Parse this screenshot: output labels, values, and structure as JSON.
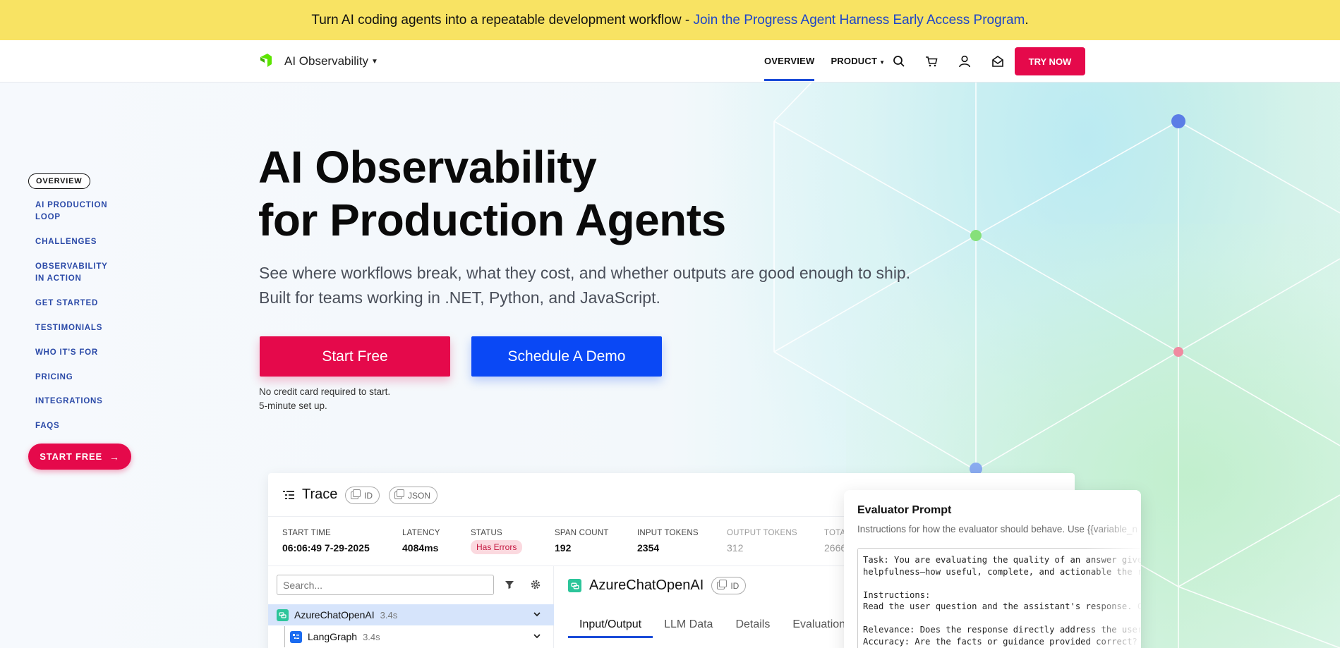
{
  "banner": {
    "text": "Turn AI coding agents into a repeatable development workflow - ",
    "link": "Join the Progress Agent Harness Early Access Program",
    "end": "."
  },
  "nav": {
    "product_name": "AI Observability",
    "overview": "OVERVIEW",
    "product": "PRODUCT",
    "try_now": "TRY NOW",
    "icons": [
      "search-icon",
      "cart-icon",
      "user-icon",
      "mail-icon"
    ]
  },
  "sidenav": {
    "active": "OVERVIEW",
    "items": [
      "AI PRODUCTION LOOP",
      "CHALLENGES",
      "OBSERVABILITY IN ACTION",
      "GET STARTED",
      "TESTIMONIALS",
      "WHO IT'S FOR",
      "PRICING",
      "INTEGRATIONS",
      "FAQS"
    ],
    "cta": "START FREE"
  },
  "hero": {
    "title_line1": "AI Observability",
    "title_line2": "for Production Agents",
    "subtitle_line1": "See where workflows break, what they cost, and whether outputs are good enough to ship.",
    "subtitle_line2": "Built for teams working in .NET, Python, and JavaScript.",
    "start_free": "Start Free",
    "schedule_demo": "Schedule A Demo",
    "note_line1": "No credit card required to start.",
    "note_line2": "5-minute set up."
  },
  "trace": {
    "title": "Trace",
    "pill_id": "ID",
    "pill_json": "JSON",
    "stats": {
      "start_time_label": "START TIME",
      "start_time": "06:06:49 7-29-2025",
      "latency_label": "LATENCY",
      "latency": "4084ms",
      "status_label": "STATUS",
      "status": "Has Errors",
      "span_count_label": "SPAN COUNT",
      "span_count": "192",
      "input_tokens_label": "INPUT TOKENS",
      "input_tokens": "2354",
      "output_tokens_label": "OUTPUT TOKENS",
      "output_tokens": "312",
      "total_label": "TOTA",
      "total": "2666"
    },
    "search_placeholder": "Search...",
    "tree": [
      {
        "name": "AzureChatOpenAI",
        "duration": "3.4s"
      },
      {
        "name": "LangGraph",
        "duration": "3.4s"
      }
    ],
    "detail_title": "AzureChatOpenAI",
    "detail_pill": "ID",
    "tabs": [
      "Input/Output",
      "LLM Data",
      "Details",
      "Evaluations"
    ]
  },
  "evaluator": {
    "title": "Evaluator Prompt",
    "subtitle": "Instructions for how the evaluator should behave. Use {{variable_n",
    "prompt": "Task: You are evaluating the quality of an answer given\nhelpfulness—how useful, complete, and actionable the re\n\nInstructions:\nRead the user question and the assistant's response. Co\n\nRelevance: Does the response directly address the user'\nAccuracy: Are the facts or guidance provided correct?"
  },
  "colors": {
    "banner": "#f8e363",
    "brand_red": "#e5094b",
    "brand_blue": "#0a48f5",
    "link_blue": "#1c44c9",
    "sidenav_text": "#2b4aa8"
  }
}
